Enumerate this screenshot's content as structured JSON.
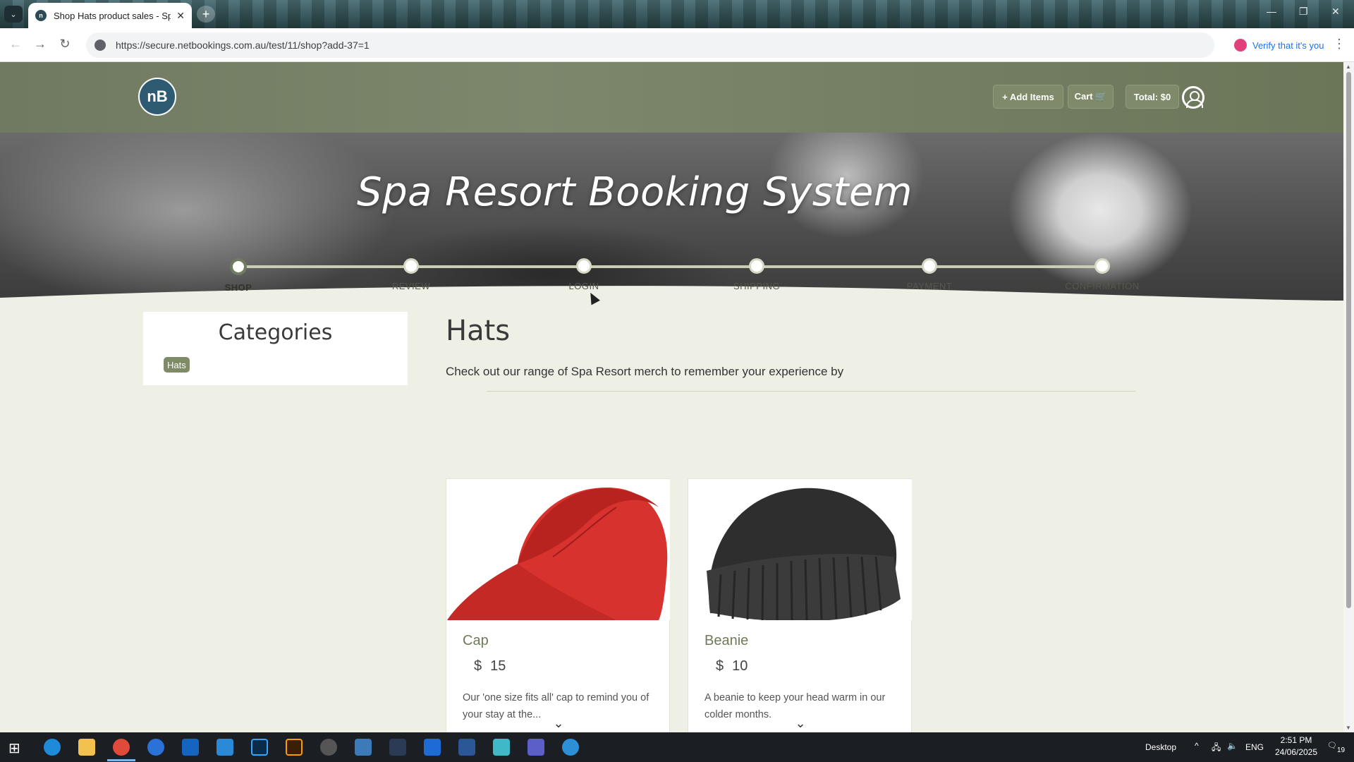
{
  "browser": {
    "tab_title": "Shop Hats product sales - Spa R",
    "url": "https://secure.netbookings.com.au/test/11/shop?add-37=1",
    "verify_label": "Verify that it's you",
    "tab_list_icon": "chevron-down-icon",
    "favicon_text": "n"
  },
  "header": {
    "logo_text": "nB",
    "add_items_label": "+ Add Items",
    "cart_label": "Cart 🛒",
    "total_label": "Total: $0"
  },
  "hero": {
    "title": "Spa Resort Booking System"
  },
  "steps": [
    {
      "label": "SHOP",
      "active": true
    },
    {
      "label": "REVIEW",
      "active": false
    },
    {
      "label": "LOGIN",
      "active": false
    },
    {
      "label": "SHIPPING",
      "active": false
    },
    {
      "label": "PAYMENT",
      "active": false
    },
    {
      "label": "CONFIRMATION",
      "active": false
    }
  ],
  "categories": {
    "title": "Categories",
    "items": [
      "Hats"
    ]
  },
  "section": {
    "title": "Hats",
    "description": "Check out our range of Spa Resort merch to remember your experience by"
  },
  "products": [
    {
      "name": "Cap",
      "currency": "$",
      "price": "15",
      "description": "Our 'one size fits all' cap to remind you of your stay at the...",
      "image": "red-cap-image"
    },
    {
      "name": "Beanie",
      "currency": "$",
      "price": "10",
      "description": "A beanie to keep your head warm in our colder months.",
      "image": "grey-beanie-image"
    }
  ],
  "taskbar": {
    "desktop_label": "Desktop",
    "lang": "ENG",
    "time": "2:51 PM",
    "date": "24/06/2025",
    "notifications": "19"
  },
  "colors": {
    "accent": "#7f8a67",
    "header_bg": "#737d62",
    "page_bg": "#eef0e6"
  }
}
